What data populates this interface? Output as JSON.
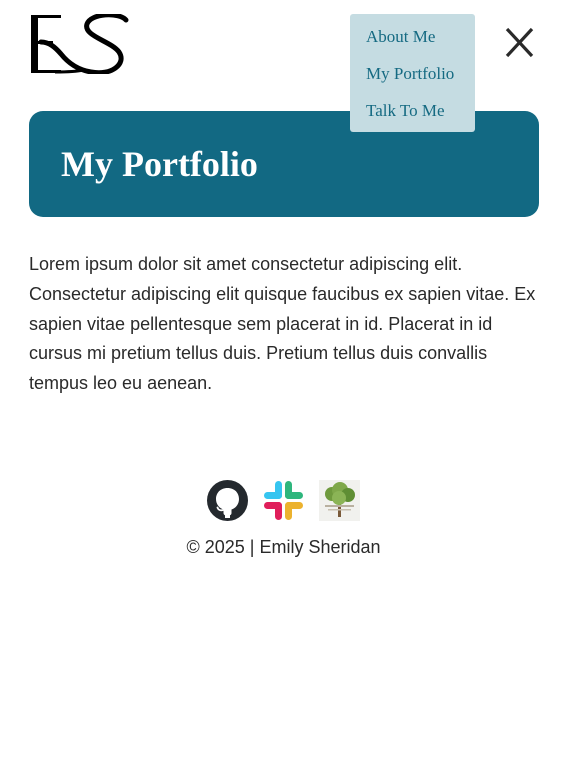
{
  "header": {
    "logo_text": "ES"
  },
  "nav": {
    "items": [
      {
        "label": "About Me"
      },
      {
        "label": "My Portfolio"
      },
      {
        "label": "Talk To Me"
      }
    ],
    "close_icon": "close-icon"
  },
  "hero": {
    "title": "My Portfolio"
  },
  "main": {
    "body": "Lorem ipsum dolor sit amet consectetur adipiscing elit. Consectetur adipiscing elit quisque faucibus ex sapien vitae. Ex sapien vitae pellentesque sem placerat in id. Placerat in id cursus mi pretium tellus duis. Pretium tellus duis convallis tempus leo eu aenean."
  },
  "footer": {
    "social": [
      {
        "icon": "github-icon"
      },
      {
        "icon": "slack-icon"
      },
      {
        "icon": "tree-logo-icon"
      }
    ],
    "copyright": "© 2025 | Emily Sheridan"
  },
  "colors": {
    "primary": "#126983",
    "menu_bg": "#c5dce2",
    "menu_text": "#156a82",
    "text": "#2a2a2a"
  }
}
